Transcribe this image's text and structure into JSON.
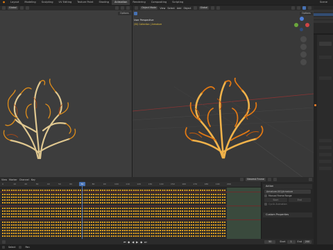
{
  "workspaces": [
    "Layout",
    "Modeling",
    "Sculpting",
    "UV Editing",
    "Texture Paint",
    "Shading",
    "Animation",
    "Rendering",
    "Compositing",
    "Scripting"
  ],
  "active_workspace_index": 6,
  "scene": {
    "name": "Scene"
  },
  "left_view": {
    "header": {
      "orientation": "Global"
    },
    "options_label": "Options"
  },
  "right_view": {
    "header": {
      "mode": "Object Mode",
      "menus": [
        "View",
        "Select",
        "Add",
        "Object"
      ],
      "orientation": "Global"
    },
    "overlay_title": "User Perspective",
    "overlay_sub": "(50) Collection | Armature",
    "options_label": "Options"
  },
  "dopesheet": {
    "menus": [
      "View",
      "Marker",
      "Channel",
      "Key"
    ],
    "keyframe_label": "Nearest Frame",
    "ticks": [
      "0",
      "10",
      "20",
      "30",
      "40",
      "50",
      "60",
      "70",
      "80",
      "90",
      "100",
      "110",
      "120",
      "130",
      "140",
      "150",
      "160",
      "170",
      "180",
      "190",
      "200"
    ],
    "current_frame": "50"
  },
  "action_panel": {
    "section_action": "Action",
    "action_name": "Armature.001|Armature",
    "manual_range": "Manual Frame Range",
    "start_label": "Start",
    "end_label": "End",
    "cyclic": "Cyclic Animation",
    "custom_props": "Custom Properties"
  },
  "playback": {
    "current": "50",
    "start_label": "Start",
    "start": "1",
    "end_label": "End",
    "end": "200"
  },
  "status": {
    "select": "Select",
    "pan": "Pan"
  },
  "colors": {
    "accent": "#4772b3",
    "key": "#e0a020",
    "plant": "#d98a1c"
  }
}
